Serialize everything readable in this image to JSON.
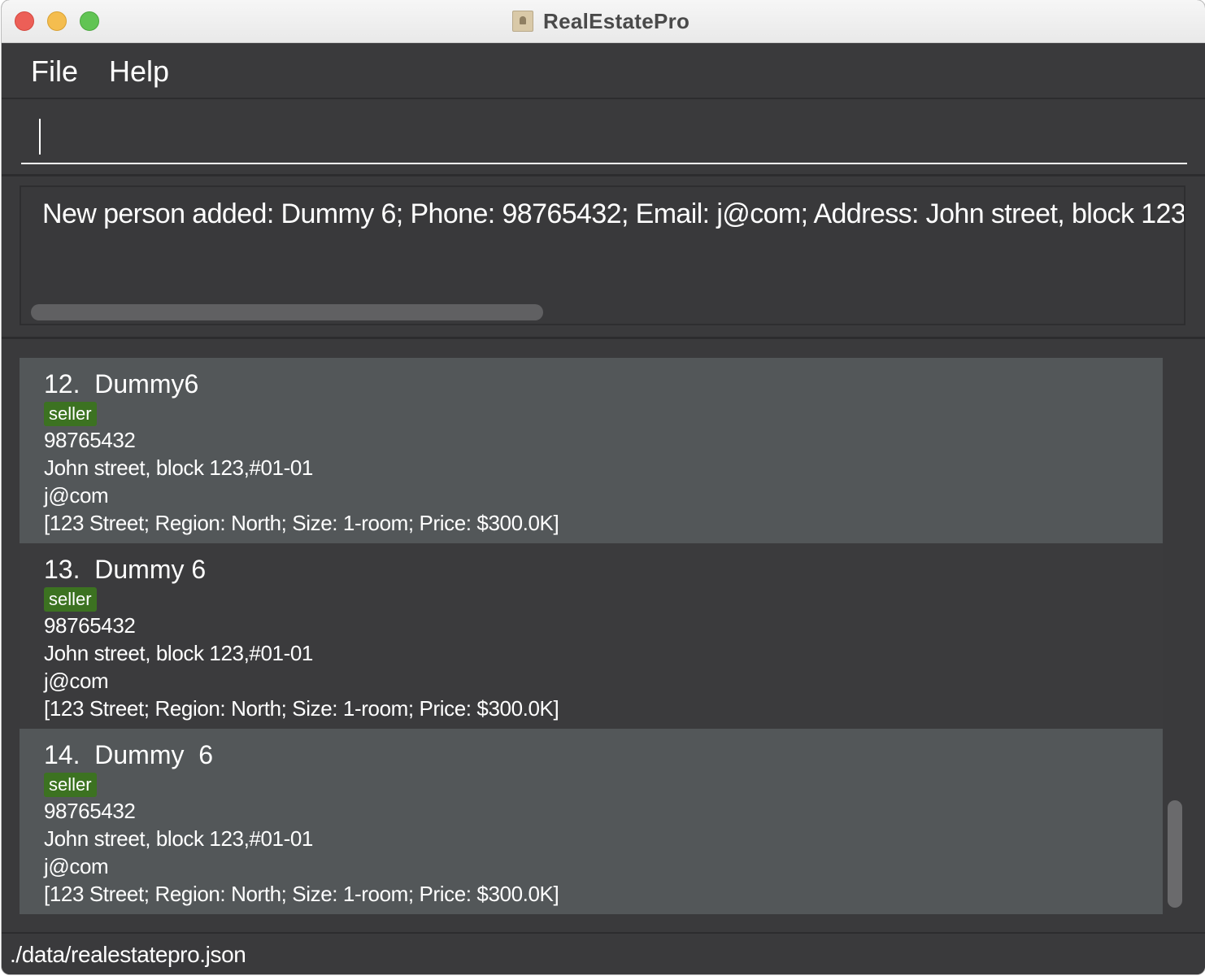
{
  "window": {
    "title": "RealEstatePro"
  },
  "menu": {
    "file_label": "File",
    "help_label": "Help"
  },
  "command": {
    "value": "",
    "placeholder": ""
  },
  "result": {
    "message": "New person added: Dummy  6; Phone: 98765432; Email: j@com; Address: John street, block 123,"
  },
  "persons": [
    {
      "index": "12.",
      "name": "Dummy6",
      "tag": "seller",
      "phone": "98765432",
      "address": "John street, block 123,#01-01",
      "email": "j@com",
      "property": "[123 Street; Region: North; Size: 1-room; Price: $300.0K]"
    },
    {
      "index": "13.",
      "name": "Dummy 6",
      "tag": "seller",
      "phone": "98765432",
      "address": "John street, block 123,#01-01",
      "email": "j@com",
      "property": "[123 Street; Region: North; Size: 1-room; Price: $300.0K]"
    },
    {
      "index": "14.",
      "name": "Dummy  6",
      "tag": "seller",
      "phone": "98765432",
      "address": "John street, block 123,#01-01",
      "email": "j@com",
      "property": "[123 Street; Region: North; Size: 1-room; Price: $300.0K]"
    }
  ],
  "status": {
    "file_path": "./data/realestatepro.json"
  },
  "colors": {
    "background": "#3a3a3c",
    "card_light": "#535759",
    "card_dark": "#3b3b3d",
    "tag": "#3c7221",
    "text": "#ffffff"
  }
}
